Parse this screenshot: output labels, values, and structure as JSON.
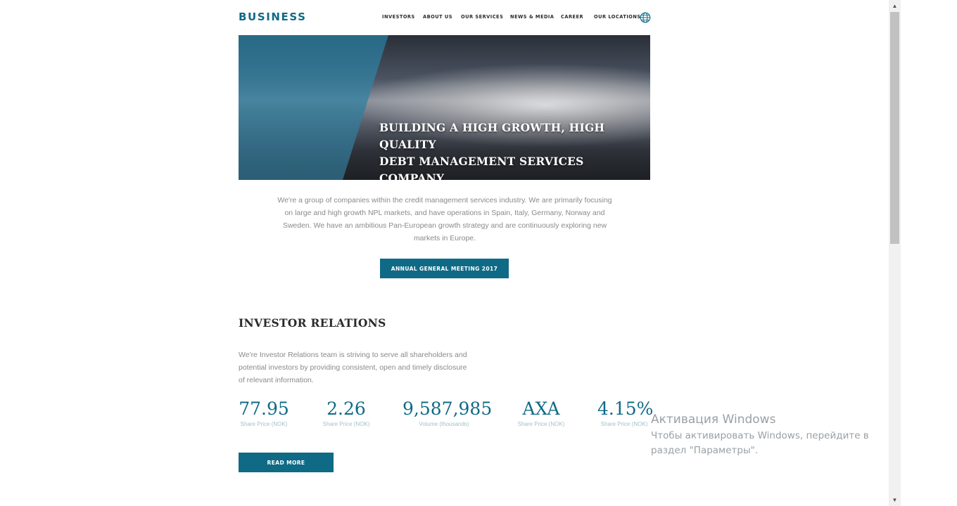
{
  "header": {
    "logo": "BUSINESS",
    "nav": [
      "INVESTORS",
      "ABOUT US",
      "OUR SERVICES",
      "NEWS & MEDIA",
      "CAREER",
      "OUR LOCATIONS"
    ],
    "globe_icon": "globe-icon"
  },
  "hero": {
    "title_line1": "BUILDING A HIGH GROWTH, HIGH QUALITY",
    "title_line2": "DEBT MANAGEMENT SERVICES COMPANY"
  },
  "intro": {
    "text": "We're a group of companies within the credit management services industry. We are primarily focusing on large and high growth NPL markets, and have operations in Spain, Italy, Germany, Norway and Sweden. We have an ambitious Pan-European growth strategy and are continuously exploring new markets in Europe.",
    "button": "ANNUAL GENERAL MEETING 2017"
  },
  "investor_relations": {
    "title": "INVESTOR RELATIONS",
    "text": "We're Investor Relations team is striving to serve all shareholders and potential investors by providing consistent, open and timely disclosure of relevant information.",
    "stats": [
      {
        "value": "77.95",
        "label": "Share Price (NOK)"
      },
      {
        "value": "2.26",
        "label": "Share Price (NOK)"
      },
      {
        "value": "9,587,985",
        "label": "Volume (thousands)"
      },
      {
        "value": "AXA",
        "label": "Share Price (NOK)"
      },
      {
        "value": "4.15%",
        "label": "Share Price (NOK)"
      }
    ],
    "button": "READ MORE"
  },
  "watermark": {
    "line1": "Активация Windows",
    "line2": "Чтобы активировать Windows, перейдите в",
    "line3": "раздел \"Параметры\"."
  },
  "colors": {
    "accent": "#0f6a86",
    "text_muted": "#8a8a8a"
  }
}
